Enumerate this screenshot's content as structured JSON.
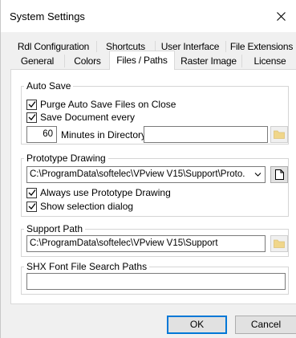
{
  "window": {
    "title": "System Settings",
    "close_glyph": "×"
  },
  "tabs": {
    "row1": [
      "Rdl Configuration",
      "Shortcuts",
      "User Interface",
      "File Extensions"
    ],
    "row2": [
      "General",
      "Colors",
      "Files / Paths",
      "Raster Image",
      "License"
    ],
    "active": "Files / Paths"
  },
  "auto_save": {
    "title": "Auto Save",
    "purge_label": "Purge Auto Save Files on Close",
    "purge_checked": true,
    "save_doc_label": "Save Document every",
    "save_doc_checked": true,
    "minutes_value": "60",
    "minutes_label": "Minutes in Directory",
    "directory_value": ""
  },
  "prototype": {
    "title": "Prototype Drawing",
    "path_value": "C:\\ProgramData\\softelec\\VPview V15\\Support\\Proto.",
    "always_label": "Always use Prototype Drawing",
    "always_checked": true,
    "show_dialog_label": "Show selection dialog",
    "show_dialog_checked": true
  },
  "support_path": {
    "title": "Support Path",
    "path_value": "C:\\ProgramData\\softelec\\VPview V15\\Support"
  },
  "shx": {
    "title": "SHX Font File Search Paths",
    "value": ""
  },
  "buttons": {
    "ok": "OK",
    "cancel": "Cancel"
  },
  "colors": {
    "accent": "#0078d7",
    "folder": "#e8c15a"
  }
}
